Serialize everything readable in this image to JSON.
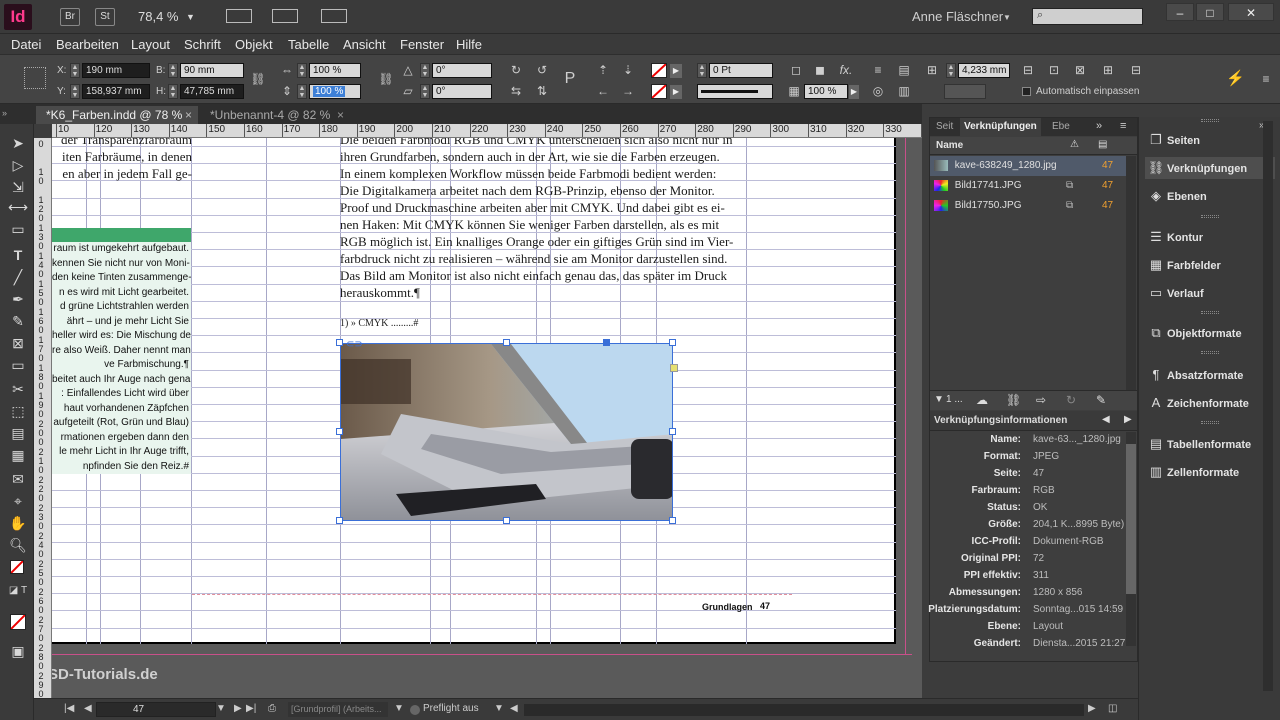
{
  "titlebar": {
    "app_logo": "Id",
    "bridge_label": "Br",
    "stock_label": "St",
    "zoom_value": "78,4 %",
    "user_name": "Anne Fläschner",
    "search_placeholder": ""
  },
  "menu": [
    "Datei",
    "Bearbeiten",
    "Layout",
    "Schrift",
    "Objekt",
    "Tabelle",
    "Ansicht",
    "Fenster",
    "Hilfe"
  ],
  "control": {
    "x_label": "X:",
    "x_value": "190 mm",
    "y_label": "Y:",
    "y_value": "158,937 mm",
    "w_label": "B:",
    "w_value": "90 mm",
    "h_label": "H:",
    "h_value": "47,785 mm",
    "scale_x": "100 %",
    "scale_y": "100 %",
    "angle": "0°",
    "shear": "0°",
    "stroke_weight": "0 Pt",
    "opacity": "100 %",
    "offset": "4,233 mm",
    "autofit_label": "Automatisch einpassen"
  },
  "tabs": [
    {
      "label": "*K6_Farben.indd @ 78 %",
      "close": "×"
    },
    {
      "label": "*Unbenannt-4 @ 82 %",
      "close": "×"
    }
  ],
  "ruler_h": [
    "10",
    "120",
    "130",
    "140",
    "150",
    "160",
    "170",
    "180",
    "190",
    "200",
    "210",
    "220",
    "230",
    "240",
    "250",
    "260",
    "270",
    "280",
    "290",
    "300",
    "310",
    "320",
    "330",
    "340"
  ],
  "ruler_v": [
    "0",
    "1 0",
    "1 2 0",
    "1 3 0",
    "1 4 0",
    "1 5 0",
    "1 6 0",
    "1 7 0",
    "1 8 0",
    "1 9 0",
    "2 0 0",
    "2 1 0",
    "2 2 0",
    "2 3 0",
    "2 4 0",
    "2 5 0",
    "2 6 0",
    "2 7 0",
    "2 8 0",
    "2 9 0"
  ],
  "document": {
    "left_col_top": [
      "der Transparenzfarbraum",
      "iten Farbräume, in denen",
      "en aber in jedem Fall ge-"
    ],
    "left_col_box": [
      "raum ist umgekehrt aufgebaut.",
      "kennen Sie nicht nur von Moni-",
      "den keine Tinten zusammenge-",
      "n es wird mit Licht gearbeitet.",
      "d grüne Lichtstrahlen werden",
      "ährt – und je mehr Licht Sie",
      "heller wird es: Die Mischung der",
      "re also Weiß. Daher nennt man",
      "ve Farbmischung.¶",
      "beitet auch Ihr Auge nach genau",
      ": Einfallendes Licht wird über",
      "haut vorhandenen Zäpfchen",
      "aufgeteilt (Rot, Grün und Blau)",
      "rmationen ergeben dann den",
      "le mehr Licht in Ihr Auge trifft,",
      "npfinden Sie den Reiz.#"
    ],
    "main_text": [
      "Die beiden Farbmodi RGB und CMYK unterscheiden sich also nicht nur in",
      "ihren Grundfarben, sondern auch in der Art, wie sie die Farben erzeugen.",
      "In einem komplexen Workflow müssen beide Farbmodi bedient werden:",
      "Die Digitalkamera arbeitet nach dem RGB-Prinzip, ebenso der Monitor.",
      "Proof und Druckmaschine arbeiten aber mit CMYK. Und dabei gibt es ei-",
      "nen Haken: Mit CMYK können Sie weniger Farben darstellen, als es mit",
      "RGB möglich ist. Ein knalliges Orange oder ein giftiges Grün sind im Vier-",
      "farbdruck nicht zu realisieren – während sie am Monitor darzustellen sind.",
      "Das Bild am Monitor ist also nicht einfach genau das, das später im Druck",
      "herauskommt.¶"
    ],
    "caption": "1) » CMYK .........#",
    "footer_label": "Grundlagen",
    "footer_page": "47"
  },
  "links_panel": {
    "tabs": [
      "Seit",
      "Verknüpfungen",
      "Ebe"
    ],
    "col_name": "Name",
    "rows": [
      {
        "name": "kave-638249_1280.jpg",
        "page": "47"
      },
      {
        "name": "Bild17741.JPG",
        "page": "47"
      },
      {
        "name": "Bild17750.JPG",
        "page": "47"
      }
    ],
    "count_label": "1 ...",
    "info_title": "Verknüpfungsinformationen",
    "info": [
      {
        "key": "Name:",
        "value": "kave-63..._1280.jpg"
      },
      {
        "key": "Format:",
        "value": "JPEG"
      },
      {
        "key": "Seite:",
        "value": "47"
      },
      {
        "key": "Farbraum:",
        "value": "RGB"
      },
      {
        "key": "Status:",
        "value": "OK"
      },
      {
        "key": "Größe:",
        "value": "204,1 K...8995 Byte)"
      },
      {
        "key": "ICC-Profil:",
        "value": "Dokument-RGB"
      },
      {
        "key": "Original PPI:",
        "value": "72"
      },
      {
        "key": "PPI effektiv:",
        "value": "311"
      },
      {
        "key": "Abmessungen:",
        "value": "1280 x 856"
      },
      {
        "key": "Platzierungsdatum:",
        "value": "Sonntag...015 14:59"
      },
      {
        "key": "Ebene:",
        "value": "Layout"
      },
      {
        "key": "Geändert:",
        "value": "Diensta...2015 21:27"
      }
    ]
  },
  "side_panel": [
    {
      "label": "Seiten",
      "icon": "pages-icon"
    },
    {
      "label": "Verknüpfungen",
      "icon": "links-icon"
    },
    {
      "label": "Ebenen",
      "icon": "layers-icon"
    },
    {
      "label": "Kontur",
      "icon": "stroke-icon"
    },
    {
      "label": "Farbfelder",
      "icon": "swatches-icon"
    },
    {
      "label": "Verlauf",
      "icon": "gradient-icon"
    },
    {
      "label": "Objektformate",
      "icon": "object-styles-icon"
    },
    {
      "label": "Absatzformate",
      "icon": "paragraph-styles-icon"
    },
    {
      "label": "Zeichenformate",
      "icon": "character-styles-icon"
    },
    {
      "label": "Tabellenformate",
      "icon": "table-styles-icon"
    },
    {
      "label": "Zellenformate",
      "icon": "cell-styles-icon"
    }
  ],
  "statusbar": {
    "page": "47",
    "profile": "[Grundprofil] (Arbeits...",
    "preflight": "Preflight aus"
  },
  "watermark": "PSD-Tutorials.de"
}
